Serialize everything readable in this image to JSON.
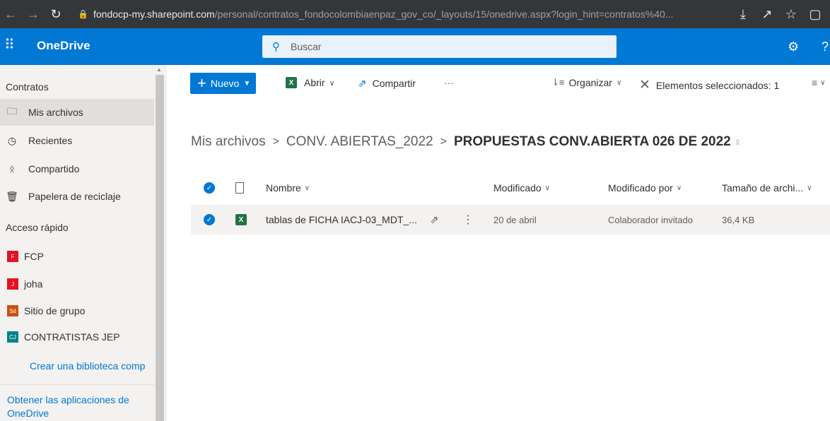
{
  "browser": {
    "url_host": "fondocp-my.sharepoint.com",
    "url_path": "/personal/contratos_fondocolombiaenpaz_gov_co/_layouts/15/onedrive.aspx?login_hint=contratos%40..."
  },
  "header": {
    "brand": "OneDrive",
    "search_placeholder": "Buscar"
  },
  "sidebar": {
    "section_title": "Contratos",
    "nav": [
      {
        "label": "Mis archivos",
        "icon": "folder-icon",
        "selected": true
      },
      {
        "label": "Recientes",
        "icon": "clock-icon"
      },
      {
        "label": "Compartido",
        "icon": "people-icon"
      },
      {
        "label": "Papelera de reciclaje",
        "icon": "trash-icon"
      }
    ],
    "quick_access_title": "Acceso rápido",
    "quick_access": [
      {
        "label": "FCP",
        "badge": "F",
        "color": "#e81123"
      },
      {
        "label": "joha",
        "badge": "J",
        "color": "#e81123"
      },
      {
        "label": "Sitio de grupo",
        "badge": "Sd",
        "color": "#ca5010"
      },
      {
        "label": "CONTRATISTAS JEP",
        "badge": "CJ",
        "color": "#038387"
      }
    ],
    "create_library": "Crear una biblioteca comp",
    "get_apps": "Obtener las aplicaciones de OneDrive"
  },
  "commandbar": {
    "new": "Nuevo",
    "open": "Abrir",
    "share": "Compartir",
    "more": "···",
    "sort": "Organizar",
    "selected": "Elementos seleccionados: 1"
  },
  "breadcrumb": {
    "root": "Mis archivos",
    "middle": "CONV. ABIERTAS_2022",
    "current": "PROPUESTAS CONV.ABIERTA 026 DE 2022"
  },
  "list": {
    "columns": {
      "name": "Nombre",
      "modified": "Modificado",
      "modified_by": "Modificado por",
      "size": "Tamaño de archi..."
    },
    "rows": [
      {
        "name": "tablas de FICHA IACJ-03_MDT_...",
        "modified": "20 de abril",
        "modified_by": "Colaborador invitado",
        "size": "36,4 KB"
      }
    ]
  },
  "colors": {
    "accent": "#0078d4",
    "excel": "#217346"
  }
}
